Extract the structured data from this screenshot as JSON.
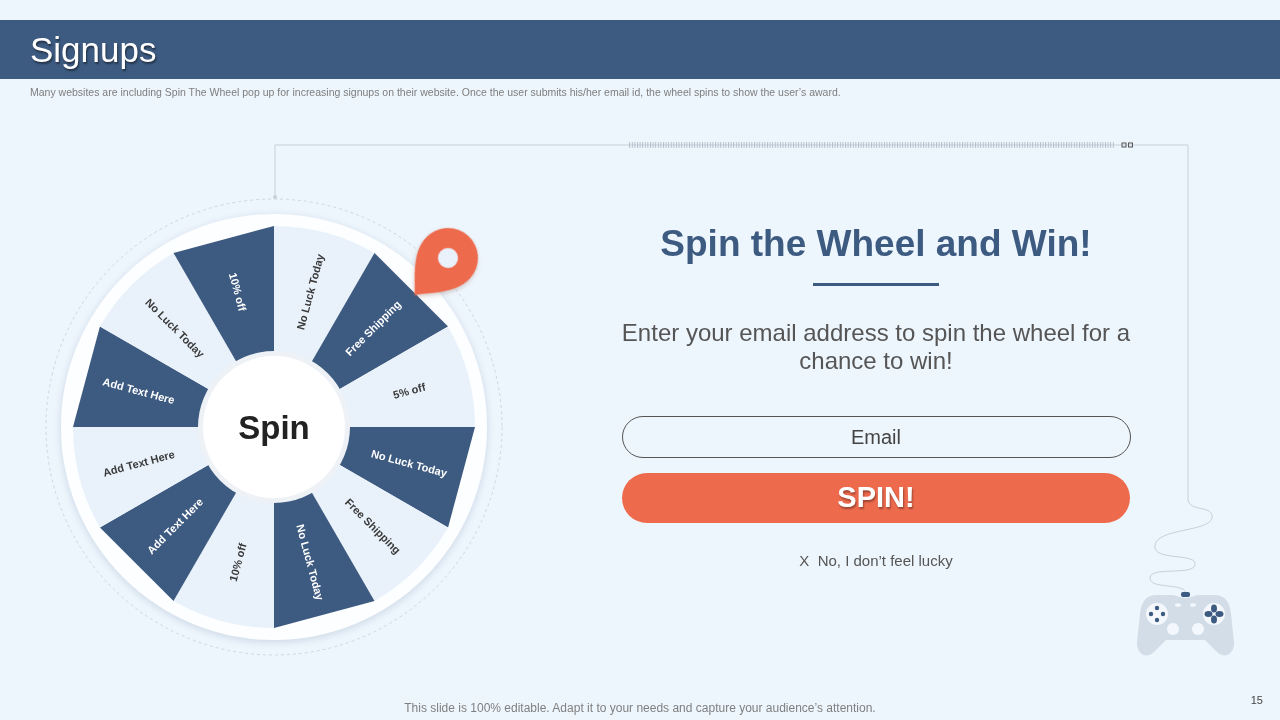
{
  "header": {
    "title": "Signups"
  },
  "description": "Many websites are including Spin The Wheel pop up for increasing signups on their website. Once the user submits his/her email id, the wheel spins to show the user’s award.",
  "wheel": {
    "hub_label": "Spin",
    "segments": [
      {
        "label": "No Luck Today",
        "kind": "light"
      },
      {
        "label": "Free Shipping",
        "kind": "dark"
      },
      {
        "label": "5% off",
        "kind": "light"
      },
      {
        "label": "No Luck Today",
        "kind": "dark"
      },
      {
        "label": "Free Shipping",
        "kind": "light"
      },
      {
        "label": "No Luck Today",
        "kind": "dark"
      },
      {
        "label": "10% off",
        "kind": "light"
      },
      {
        "label": "Add Text Here",
        "kind": "dark"
      },
      {
        "label": "Add Text Here",
        "kind": "light"
      },
      {
        "label": "Add Text Here",
        "kind": "dark"
      },
      {
        "label": "No Luck Today",
        "kind": "light"
      },
      {
        "label": "10% off",
        "kind": "dark"
      }
    ]
  },
  "form": {
    "heading": "Spin the Wheel and Win!",
    "prompt": "Enter your email address to spin the wheel for a chance to win!",
    "email_field": {
      "placeholder": "Email"
    },
    "submit_button": "SPIN!",
    "dismiss_link": "X  No, I don’t feel lucky"
  },
  "footer": {
    "note": "This slide is 100% editable. Adapt it to your needs and capture your audience’s attention.",
    "page_number": "15"
  }
}
